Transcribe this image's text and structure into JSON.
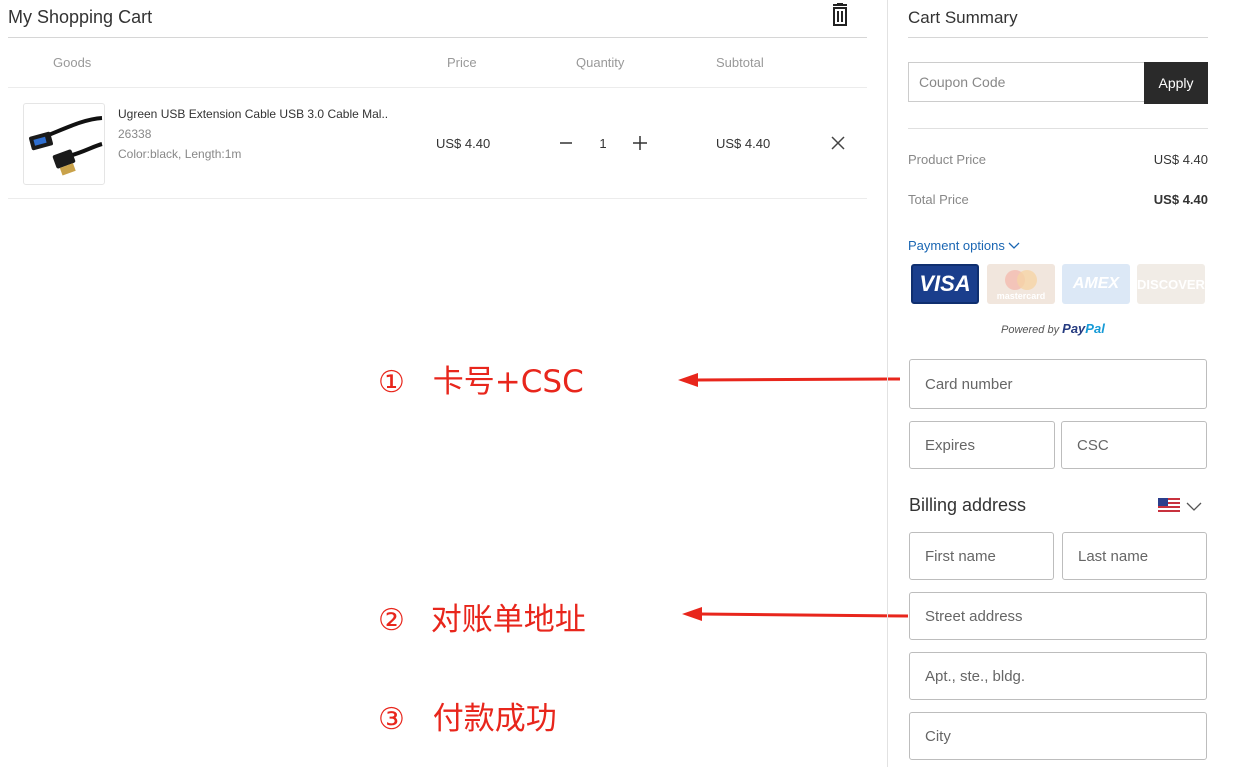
{
  "cart": {
    "title": "My Shopping Cart",
    "columns": {
      "goods": "Goods",
      "price": "Price",
      "quantity": "Quantity",
      "subtotal": "Subtotal"
    },
    "item": {
      "name": "Ugreen USB Extension Cable USB 3.0 Cable Mal...",
      "sku": "26338",
      "attributes": "Color:black, Length:1m",
      "price": "US$ 4.40",
      "quantity": "1",
      "subtotal": "US$ 4.40"
    }
  },
  "annotations": [
    {
      "num": "①",
      "text": "卡号+CSC"
    },
    {
      "num": "②",
      "text": "对账单地址"
    },
    {
      "num": "③",
      "text": "付款成功"
    }
  ],
  "summary": {
    "title": "Cart Summary",
    "coupon_placeholder": "Coupon Code",
    "apply_label": "Apply",
    "product_price_label": "Product Price",
    "product_price_value": "US$ 4.40",
    "total_price_label": "Total Price",
    "total_price_value": "US$ 4.40",
    "payment_options": "Payment options",
    "cards": [
      "VISA",
      "mastercard",
      "AMEX",
      "DISCOVER"
    ],
    "powered_by": "Powered by",
    "paypal": {
      "pay": "Pay",
      "pal": "Pal"
    }
  },
  "form": {
    "card_number": "Card number",
    "expires": "Expires",
    "csc": "CSC",
    "billing_title": "Billing address",
    "first_name": "First name",
    "last_name": "Last name",
    "street": "Street address",
    "apt": "Apt., ste., bldg.",
    "city": "City"
  },
  "colors": {
    "accent_dark": "#2a2a2a",
    "link": "#1a66b3",
    "annotation": "#e8261c",
    "paypal_dark": "#253b80",
    "paypal_light": "#179bd7"
  }
}
